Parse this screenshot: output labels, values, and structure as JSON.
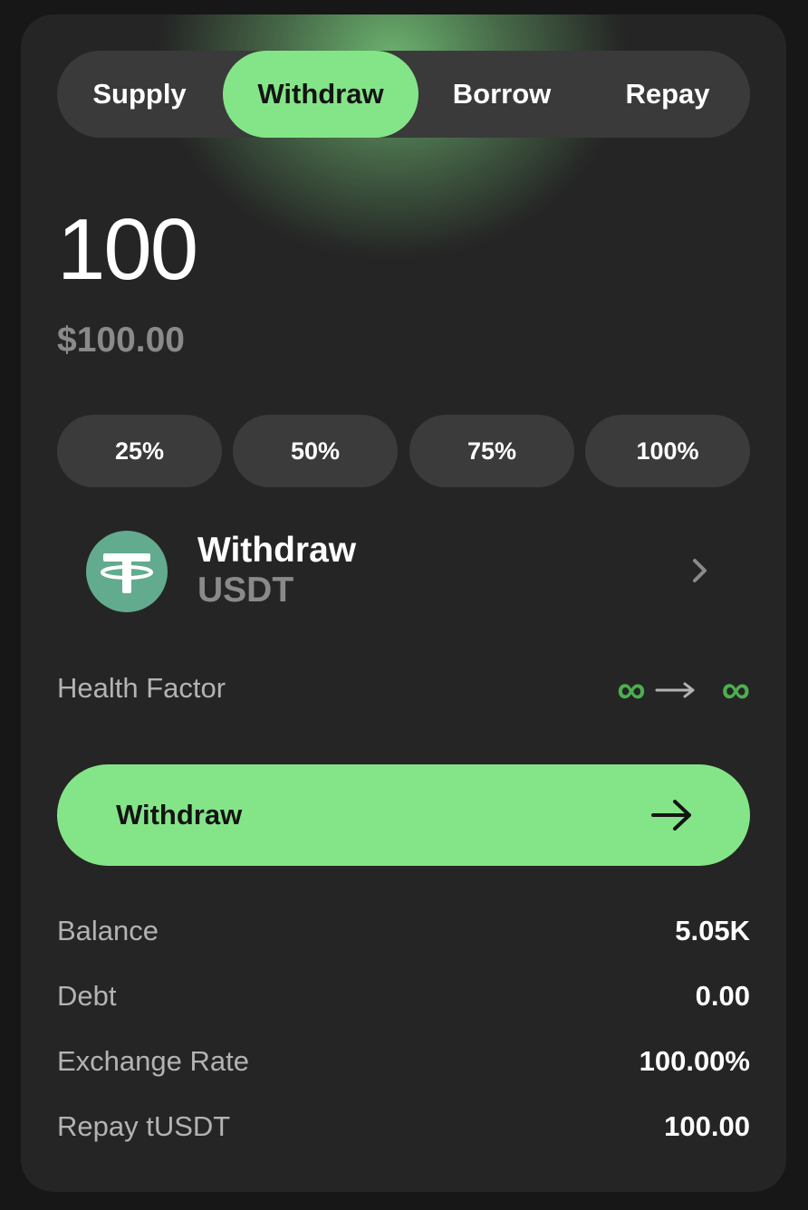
{
  "tabs": [
    {
      "label": "Supply",
      "active": false
    },
    {
      "label": "Withdraw",
      "active": true
    },
    {
      "label": "Borrow",
      "active": false
    },
    {
      "label": "Repay",
      "active": false
    }
  ],
  "amount": {
    "value": "100",
    "usd": "$100.00"
  },
  "percent_buttons": [
    "25%",
    "50%",
    "75%",
    "100%"
  ],
  "asset": {
    "action": "Withdraw",
    "symbol": "USDT",
    "icon": "tether-icon"
  },
  "health_factor": {
    "label": "Health Factor",
    "from": "∞",
    "to": "∞",
    "color": "#4caf50"
  },
  "cta": {
    "label": "Withdraw",
    "icon": "arrow-right-icon"
  },
  "details": [
    {
      "label": "Balance",
      "value": "5.05K"
    },
    {
      "label": "Debt",
      "value": "0.00"
    },
    {
      "label": "Exchange Rate",
      "value": "100.00%"
    },
    {
      "label": "Repay tUSDT",
      "value": "100.00"
    }
  ],
  "colors": {
    "accent": "#84e588",
    "card": "#252525",
    "pill": "#3b3b3b",
    "muted": "#8a8a8a"
  }
}
